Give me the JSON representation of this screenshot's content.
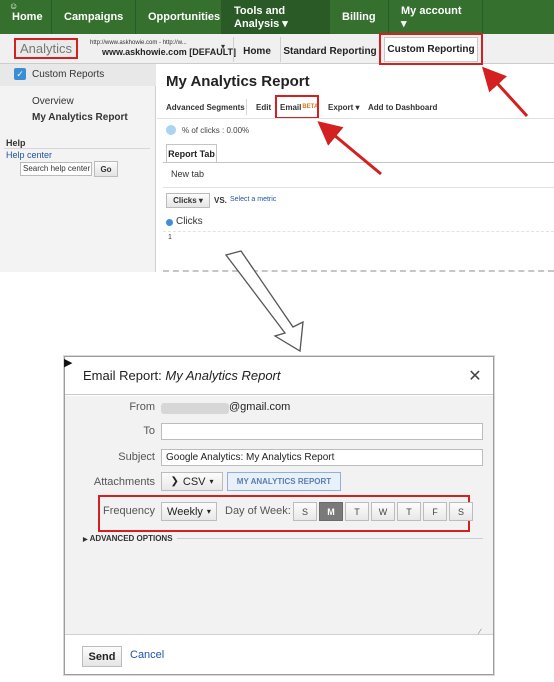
{
  "nav": {
    "items": [
      "Home",
      "Campaigns",
      "Opportunities",
      "Tools and Analysis ▾",
      "Billing",
      "My account ▾"
    ]
  },
  "subbar": {
    "logo": "Analytics",
    "account_url": "http://www.askhowie.com - http://w...",
    "account_name": "www.askhowie.com [DEFAULT]",
    "tabs": [
      "Home",
      "Standard Reporting",
      "Custom Reporting"
    ]
  },
  "sidebar": {
    "header": "Custom Reports",
    "overview": "Overview",
    "report": "My Analytics Report",
    "help_title": "Help",
    "help_center": "Help center",
    "search_placeholder": "Search help center",
    "go": "Go"
  },
  "report": {
    "title": "My Analytics Report",
    "toolbar": {
      "advanced_segments": "Advanced Segments",
      "edit": "Edit",
      "email": "Email",
      "beta": "BETA",
      "export": "Export ▾",
      "add_to_dashboard": "Add to Dashboard"
    },
    "segment": "% of clicks : 0.00%",
    "tab": "Report Tab",
    "new_tab": "New tab",
    "metric_button": "Clicks ▾",
    "vs": "VS.",
    "select_metric": "Select a metric",
    "legend": "Clicks",
    "y_tick": "1"
  },
  "dialog": {
    "title_prefix": "Email Report: ",
    "title_report": "My Analytics Report",
    "from_label": "From",
    "from_suffix": "@gmail.com",
    "to_label": "To",
    "to_value": "",
    "subject_label": "Subject",
    "subject_value": "Google Analytics: My Analytics Report",
    "attachments_label": "Attachments",
    "format": "CSV",
    "report_chip": "MY ANALYTICS REPORT",
    "frequency_label": "Frequency",
    "frequency_value": "Weekly",
    "dow_label": "Day of Week:",
    "days": [
      "S",
      "M",
      "T",
      "W",
      "T",
      "F",
      "S"
    ],
    "selected_day_index": 1,
    "advanced": "ADVANCED OPTIONS",
    "send": "Send",
    "cancel": "Cancel"
  },
  "colors": {
    "nav_green": "#35702f",
    "highlight_red": "#d32020",
    "link_blue": "#2054a6"
  }
}
